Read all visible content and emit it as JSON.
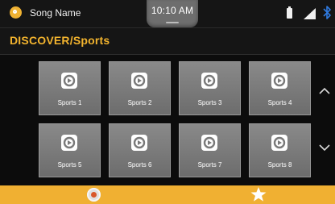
{
  "status_bar": {
    "song_name": "Song Name",
    "time": "10:10 AM",
    "icons": [
      "app-icon",
      "battery-icon",
      "signal-icon",
      "bluetooth-icon"
    ]
  },
  "header": {
    "title": "DISCOVER/Sports"
  },
  "tiles": [
    {
      "label": "Sports 1",
      "icon": "channel-icon"
    },
    {
      "label": "Sports 2",
      "icon": "channel-icon"
    },
    {
      "label": "Sports 3",
      "icon": "channel-icon"
    },
    {
      "label": "Sports 4",
      "icon": "channel-icon"
    },
    {
      "label": "Sports 5",
      "icon": "channel-icon"
    },
    {
      "label": "Sports 6",
      "icon": "channel-icon"
    },
    {
      "label": "Sports 7",
      "icon": "channel-icon"
    },
    {
      "label": "Sports 8",
      "icon": "channel-icon"
    }
  ],
  "navigation": {
    "scroll_up_icon": "chevron-up-icon",
    "scroll_down_icon": "chevron-down-icon"
  },
  "bottom_bar": {
    "home_icon": "home-icon",
    "favorites_icon": "star-icon"
  },
  "colors": {
    "accent": "#f0b032",
    "title": "#f3b42e",
    "tile": "#7c7c7c",
    "background": "#0a0a0a",
    "bluetooth": "#2f7ae0"
  }
}
